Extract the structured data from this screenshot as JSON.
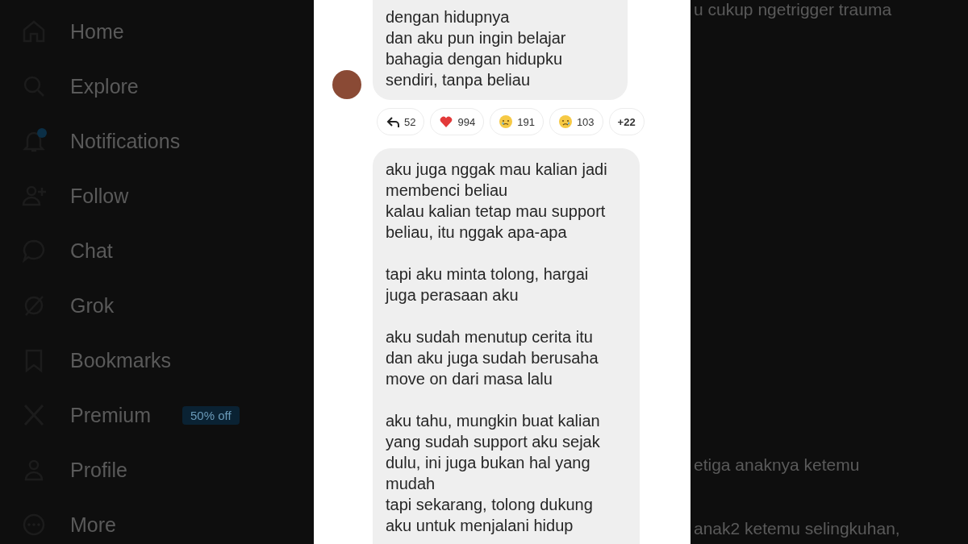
{
  "sidebar": {
    "items": [
      {
        "label": "Home",
        "unread": false
      },
      {
        "label": "Explore",
        "unread": false
      },
      {
        "label": "Notifications",
        "unread": true
      },
      {
        "label": "Follow",
        "unread": false
      },
      {
        "label": "Chat",
        "unread": false
      },
      {
        "label": "Grok",
        "unread": false
      },
      {
        "label": "Bookmarks",
        "unread": false
      },
      {
        "label": "Premium",
        "unread": false,
        "badge": "50% off"
      },
      {
        "label": "Profile",
        "unread": false
      },
      {
        "label": "More",
        "unread": false
      }
    ]
  },
  "viewer": {
    "top_message": {
      "lines": [
        "dengan hidupnya",
        "dan aku pun ingin belajar",
        "bahagia dengan hidupku",
        "sendiri, tanpa beliau"
      ]
    },
    "reactions": [
      {
        "kind": "reply",
        "count": "52"
      },
      {
        "kind": "heart",
        "count": "994"
      },
      {
        "kind": "tearful",
        "count": "191"
      },
      {
        "kind": "sad",
        "count": "103"
      },
      {
        "kind": "more",
        "count": "+22"
      }
    ],
    "second_message": {
      "paragraphs": [
        [
          "aku juga nggak mau kalian jadi",
          "membenci beliau",
          "kalau kalian tetap mau support",
          "beliau, itu nggak apa-apa"
        ],
        [
          "tapi aku minta tolong, hargai",
          "juga perasaan aku"
        ],
        [
          "aku sudah menutup cerita itu",
          "dan aku juga sudah berusaha",
          "move on dari masa lalu"
        ],
        [
          "aku tahu, mungkin buat kalian",
          "yang sudah support aku sejak",
          "dulu, ini juga bukan hal yang",
          "mudah",
          "tapi sekarang, tolong dukung",
          "aku untuk menjalani hidup"
        ]
      ]
    }
  },
  "background_post": {
    "lines": [
      "u cukup ngetrigger trauma",
      "etiga anaknya ketemu",
      "anak2 ketemu selingkuhan,"
    ]
  }
}
